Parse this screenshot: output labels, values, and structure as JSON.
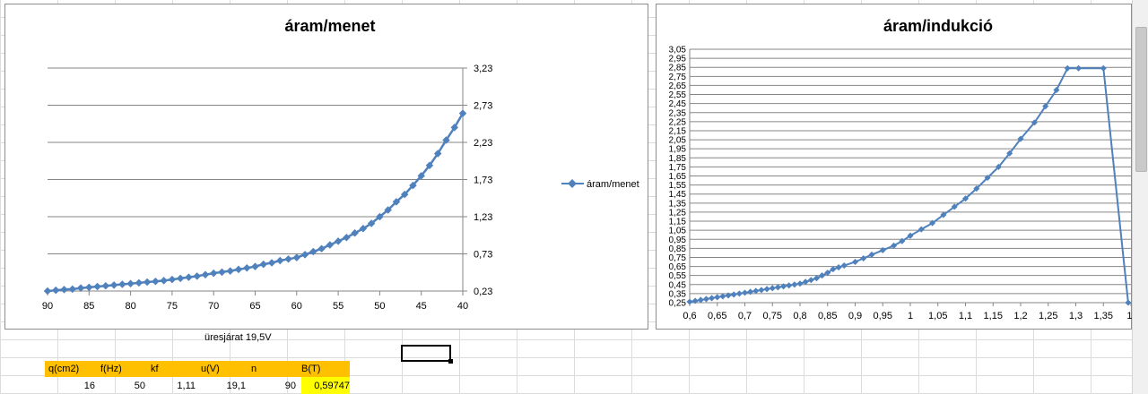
{
  "sheet": {
    "caption": "üresjárat 19,5V",
    "headers": [
      "q(cm2)",
      "f(Hz)",
      "kf",
      "u(V)",
      "n",
      "B(T)"
    ],
    "values": [
      "16",
      "50",
      "1,11",
      "19,1",
      "90",
      "0,59747"
    ],
    "highlight_color": "#ffff00",
    "header_color": "#ffc000"
  },
  "chart_data": [
    {
      "type": "line",
      "title": "áram/menet",
      "series": [
        {
          "name": "áram/menet",
          "color": "#4f81bd",
          "x": [
            90,
            89,
            88,
            87,
            86,
            85,
            84,
            83,
            82,
            81,
            80,
            79,
            78,
            77,
            76,
            75,
            74,
            73,
            72,
            71,
            70,
            69,
            68,
            67,
            66,
            65,
            64,
            63,
            62,
            61,
            60,
            59,
            58,
            57,
            56,
            55,
            54,
            53,
            52,
            51,
            50,
            49,
            48,
            47,
            46,
            45,
            44,
            43,
            42,
            41,
            40
          ],
          "y": [
            0.23,
            0.24,
            0.25,
            0.255,
            0.27,
            0.28,
            0.29,
            0.3,
            0.31,
            0.32,
            0.33,
            0.34,
            0.35,
            0.36,
            0.37,
            0.385,
            0.4,
            0.415,
            0.43,
            0.45,
            0.47,
            0.485,
            0.5,
            0.52,
            0.54,
            0.56,
            0.59,
            0.61,
            0.64,
            0.66,
            0.68,
            0.72,
            0.76,
            0.8,
            0.85,
            0.9,
            0.95,
            1.01,
            1.07,
            1.14,
            1.23,
            1.32,
            1.43,
            1.53,
            1.65,
            1.78,
            1.92,
            2.08,
            2.26,
            2.43,
            2.62
          ]
        }
      ],
      "x_ticks": [
        90,
        85,
        80,
        75,
        70,
        65,
        60,
        55,
        50,
        45,
        40
      ],
      "x_reversed": true,
      "xlim": [
        40,
        90
      ],
      "y_ticks": [
        "0,23",
        "0,73",
        "1,23",
        "1,73",
        "2,23",
        "2,73",
        "3,23"
      ],
      "ylim": [
        0.23,
        3.23
      ],
      "y_axis_side": "right",
      "grid": "horizontal",
      "legend": "right"
    },
    {
      "type": "line",
      "title": "áram/indukció",
      "series": [
        {
          "name": "",
          "color": "#4f81bd",
          "x": [
            0.6,
            0.61,
            0.62,
            0.63,
            0.64,
            0.65,
            0.66,
            0.67,
            0.68,
            0.69,
            0.7,
            0.71,
            0.72,
            0.73,
            0.74,
            0.75,
            0.76,
            0.77,
            0.78,
            0.79,
            0.8,
            0.81,
            0.82,
            0.83,
            0.84,
            0.85,
            0.86,
            0.87,
            0.88,
            0.9,
            0.915,
            0.93,
            0.95,
            0.97,
            0.985,
            1.0,
            1.02,
            1.04,
            1.06,
            1.08,
            1.1,
            1.12,
            1.14,
            1.16,
            1.18,
            1.2,
            1.225,
            1.245,
            1.265,
            1.285,
            1.305,
            1.35,
            1.395
          ],
          "y": [
            0.26,
            0.27,
            0.28,
            0.29,
            0.3,
            0.31,
            0.32,
            0.33,
            0.34,
            0.35,
            0.36,
            0.37,
            0.38,
            0.39,
            0.4,
            0.41,
            0.42,
            0.43,
            0.44,
            0.45,
            0.46,
            0.48,
            0.5,
            0.52,
            0.55,
            0.58,
            0.62,
            0.64,
            0.66,
            0.7,
            0.74,
            0.78,
            0.83,
            0.88,
            0.93,
            0.99,
            1.06,
            1.13,
            1.22,
            1.31,
            1.4,
            1.51,
            1.63,
            1.75,
            1.9,
            2.06,
            2.24,
            2.42,
            2.6,
            2.84,
            2.84,
            2.84,
            0.25
          ]
        }
      ],
      "x_ticks": [
        "0,6",
        "0,65",
        "0,7",
        "0,75",
        "0,8",
        "0,85",
        "0,9",
        "0,95",
        "1",
        "1,05",
        "1,1",
        "1,15",
        "1,2",
        "1,25",
        "1,3",
        "1,35",
        "1,"
      ],
      "xlim": [
        0.6,
        1.4
      ],
      "y_ticks": [
        "0,25",
        "0,35",
        "0,45",
        "0,55",
        "0,65",
        "0,75",
        "0,85",
        "0,95",
        "1,05",
        "1,15",
        "1,25",
        "1,35",
        "1,45",
        "1,55",
        "1,65",
        "1,75",
        "1,85",
        "1,95",
        "2,05",
        "2,15",
        "2,25",
        "2,35",
        "2,45",
        "2,55",
        "2,65",
        "2,75",
        "2,85",
        "2,95",
        "3,05"
      ],
      "ylim": [
        0.25,
        3.05
      ],
      "grid": "horizontal"
    }
  ]
}
